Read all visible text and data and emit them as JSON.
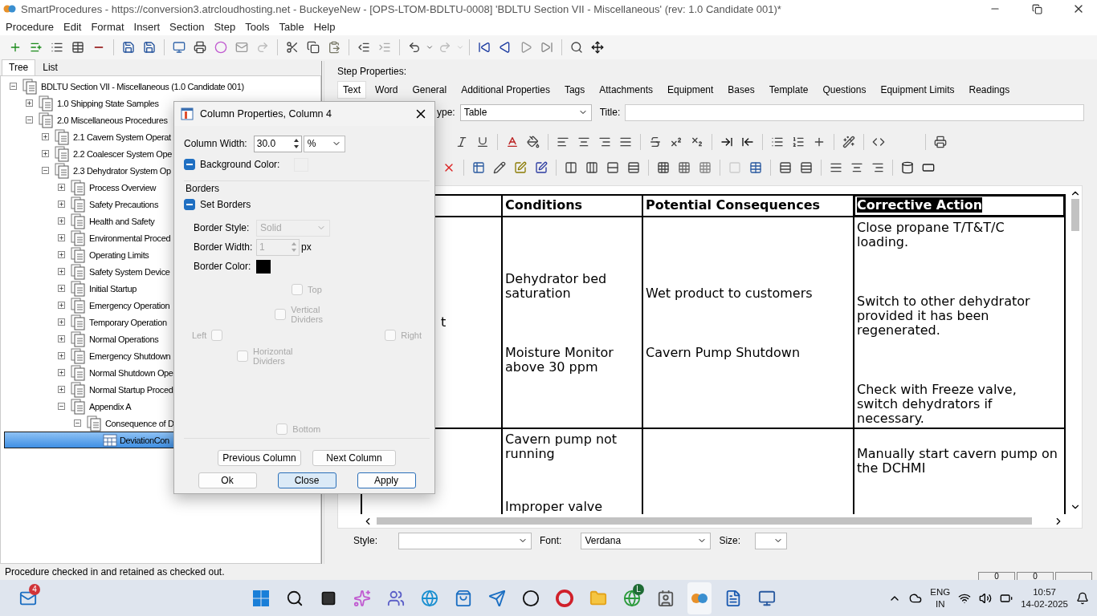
{
  "window": {
    "title": "SmartProcedures - https://conversion3.atrcloudhosting.net - BuckeyeNew - [OPS-LTOM-BDLTU-0008] 'BDLTU Section VII - Miscellaneous' (rev: 1.0 Candidate 001)*"
  },
  "menu": [
    "Procedure",
    "Edit",
    "Format",
    "Insert",
    "Section",
    "Step",
    "Tools",
    "Table",
    "Help"
  ],
  "left_tabs": [
    {
      "label": "Tree",
      "selected": true
    },
    {
      "label": "List",
      "selected": false
    }
  ],
  "tree": [
    {
      "label": "BDLTU Section VII - Miscellaneous (1.0 Candidate 001)",
      "kind": "section",
      "expanded": true,
      "selected": false,
      "children": [
        {
          "label": "1.0 Shipping State Samples",
          "kind": "section",
          "expanded": false,
          "selected": false
        },
        {
          "label": "2.0 Miscellaneous Procedures",
          "kind": "section",
          "expanded": true,
          "selected": false,
          "children": [
            {
              "label": "2.1 Cavern System Operat",
              "kind": "section",
              "expanded": false,
              "selected": false
            },
            {
              "label": "2.2 Coalescer System Ope",
              "kind": "section",
              "expanded": false,
              "selected": false
            },
            {
              "label": "2.3 Dehydrator System Op",
              "kind": "section",
              "expanded": true,
              "selected": false,
              "children": [
                {
                  "label": "Process Overview",
                  "kind": "section",
                  "expanded": false,
                  "selected": false
                },
                {
                  "label": "Safety Precautions",
                  "kind": "section",
                  "expanded": false,
                  "selected": false
                },
                {
                  "label": "Health and Safety",
                  "kind": "section",
                  "expanded": false,
                  "selected": false
                },
                {
                  "label": "Environmental Proced",
                  "kind": "section",
                  "expanded": false,
                  "selected": false
                },
                {
                  "label": "Operating Limits",
                  "kind": "section",
                  "expanded": false,
                  "selected": false
                },
                {
                  "label": "Safety System Device",
                  "kind": "section",
                  "expanded": false,
                  "selected": false
                },
                {
                  "label": "Initial Startup",
                  "kind": "section",
                  "expanded": false,
                  "selected": false
                },
                {
                  "label": "Emergency Operation",
                  "kind": "section",
                  "expanded": false,
                  "selected": false
                },
                {
                  "label": "Temporary Operation",
                  "kind": "section",
                  "expanded": false,
                  "selected": false
                },
                {
                  "label": "Normal Operations",
                  "kind": "section",
                  "expanded": false,
                  "selected": false
                },
                {
                  "label": "Emergency Shutdown",
                  "kind": "section",
                  "expanded": false,
                  "selected": false
                },
                {
                  "label": "Normal Shutdown Ope",
                  "kind": "section",
                  "expanded": false,
                  "selected": false
                },
                {
                  "label": "Normal Startup Proced",
                  "kind": "section",
                  "expanded": false,
                  "selected": false
                },
                {
                  "label": "Appendix A",
                  "kind": "section",
                  "expanded": true,
                  "selected": false,
                  "children": [
                    {
                      "label": "Consequence of D",
                      "kind": "section",
                      "expanded": true,
                      "selected": false,
                      "children": [
                        {
                          "label": "DeviationCon",
                          "kind": "table",
                          "selected": true
                        }
                      ]
                    }
                  ]
                }
              ]
            }
          ]
        }
      ]
    }
  ],
  "step_properties": {
    "label": "Step Properties:",
    "tabs": [
      {
        "label": "Text",
        "selected": true
      },
      {
        "label": "Word",
        "selected": false
      },
      {
        "label": "General",
        "selected": false
      },
      {
        "label": "Additional Properties",
        "selected": false
      },
      {
        "label": "Tags",
        "selected": false
      },
      {
        "label": "Attachments",
        "selected": false
      },
      {
        "label": "Equipment",
        "selected": false
      },
      {
        "label": "Bases",
        "selected": false
      },
      {
        "label": "Template",
        "selected": false
      },
      {
        "label": "Questions",
        "selected": false
      },
      {
        "label": "Equipment Limits",
        "selected": false
      },
      {
        "label": "Readings",
        "selected": false
      }
    ],
    "type_label": "ype:",
    "type_value": "Table",
    "title_label": "Title:"
  },
  "table": {
    "columns": [
      {
        "highlighted": false
      },
      {
        "label": "Conditions",
        "highlighted": false
      },
      {
        "label": "Potential Consequences",
        "highlighted": false
      },
      {
        "label": "Corrective Action",
        "highlighted": true
      }
    ],
    "rows": [
      {
        "cells": [
          [
            "t"
          ],
          [
            "Dehydrator bed saturation",
            "Moisture Monitor above 30 ppm"
          ],
          [
            "Wet product to customers",
            "Cavern Pump Shutdown"
          ],
          [
            "Close propane T/T&T/C loading.",
            "Switch to other dehydrator provided it has been regenerated.",
            "Check with Freeze valve, switch dehydrators if necessary."
          ]
        ]
      },
      {
        "cells": [
          [],
          [
            "Cavern pump not running",
            "Improper valve"
          ],
          [],
          [
            "Manually start cavern pump on the DCHMI"
          ]
        ]
      }
    ]
  },
  "bottom_bar": {
    "style_label": "Style:",
    "font_label": "Font:",
    "font_value": "Verdana",
    "size_label": "Size:"
  },
  "dialog": {
    "title": "Column Properties, Column 4",
    "column_width": {
      "label": "Column Width:",
      "value": "30.0",
      "unit": "%"
    },
    "background_color": {
      "label": "Background Color:",
      "checked": true
    },
    "borders_label": "Borders",
    "set_borders": {
      "label": "Set Borders",
      "checked": true
    },
    "border_style": {
      "label": "Border Style:",
      "value": "Solid",
      "disabled": true
    },
    "border_width": {
      "label": "Border Width:",
      "value": "1",
      "unit": "px",
      "disabled": true
    },
    "border_color": {
      "label": "Border Color:",
      "color": "#000000"
    },
    "sides": [
      {
        "label": "Top",
        "checked": false,
        "disabled": true
      },
      {
        "label": "Vertical Dividers",
        "checked": false,
        "disabled": true
      },
      {
        "label": "Left",
        "checked": false,
        "disabled": true
      },
      {
        "label": "Right",
        "checked": false,
        "disabled": true
      },
      {
        "label": "Horizontal Dividers",
        "checked": false,
        "disabled": true
      },
      {
        "label": "Bottom",
        "checked": false,
        "disabled": true
      }
    ],
    "nav_buttons": [
      {
        "label": "Previous Column",
        "focused": false,
        "default": false
      },
      {
        "label": "Next Column",
        "focused": false,
        "default": false
      }
    ],
    "buttons": [
      {
        "label": "Ok",
        "focused": false,
        "default": false
      },
      {
        "label": "Close",
        "focused": true,
        "default": false
      },
      {
        "label": "Apply",
        "focused": false,
        "default": true
      }
    ]
  },
  "status_bar": {
    "text": "Procedure checked in and retained as checked out.",
    "panels": [
      "0",
      "0"
    ]
  },
  "taskbar": {
    "mail_badge": "4",
    "browser_badge": "L",
    "language": "ENG",
    "region": "IN",
    "time": "10:57",
    "date": "14-02-2025"
  }
}
